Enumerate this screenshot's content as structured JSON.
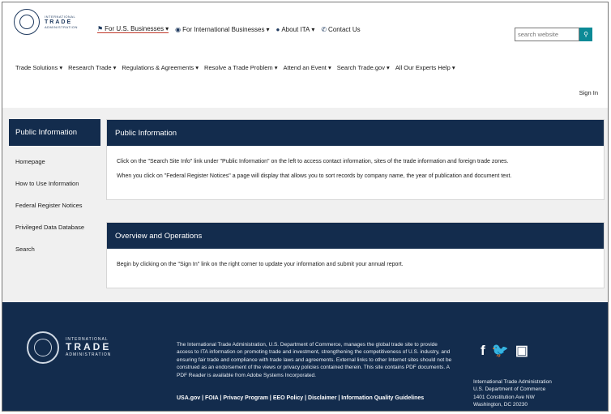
{
  "header": {
    "logo_small_top": "INTERNATIONAL",
    "logo_big": "TRADE",
    "logo_small_bottom": "ADMINISTRATION",
    "topnav": [
      {
        "label": "For U.S. Businesses",
        "icon": "flag-icon",
        "active": true
      },
      {
        "label": "For International Businesses",
        "icon": "globe-icon",
        "active": false
      },
      {
        "label": "About ITA",
        "icon": "info-icon",
        "active": false
      },
      {
        "label": "Contact Us",
        "icon": "phone-icon",
        "active": false
      }
    ],
    "search_placeholder": "search website",
    "search_icon": "search-icon",
    "mainnav": [
      "Trade Solutions",
      "Research Trade",
      "Regulations & Agreements",
      "Resolve a Trade Problem",
      "Attend an Event",
      "Search Trade.gov",
      "All Our Experts Help"
    ],
    "sign_in": "Sign In"
  },
  "sidebar": {
    "title": "Public Information",
    "items": [
      "Homepage",
      "How to Use Information",
      "Federal Register Notices",
      "Privileged Data Database",
      "Search"
    ]
  },
  "panels": [
    {
      "title": "Public Information",
      "paragraphs": [
        "Click on the \"Search Site Info\" link under \"Public Information\" on the left to access contact information, sites of the trade information and foreign trade zones.",
        "When you click on \"Federal Register Notices\" a page will display that allows you to sort records by company name, the year of publication and document text."
      ]
    },
    {
      "title": "Overview and Operations",
      "paragraphs": [
        "Begin by clicking on the \"Sign In\" link on the right corner to update your information and submit your annual report."
      ]
    }
  ],
  "footer": {
    "logo_small_top": "INTERNATIONAL",
    "logo_big": "TRADE",
    "logo_small_bottom": "ADMINISTRATION",
    "text": "The International Trade Administration, U.S. Department of Commerce, manages the global trade site to provide access to ITA information on promoting trade and investment, strengthening the competitiveness of U.S. industry, and ensuring fair trade and compliance with trade laws and agreements. External links to other Internet sites should not be construed as an endorsement of the views or privacy policies contained therein. This site contains PDF documents. A PDF Reader is available from Adobe Systems Incorporated.",
    "links": "USA.gov | FOIA | Privacy Program | EEO Policy | Disclaimer | Information Quality Guidelines",
    "social": [
      "f",
      "🐦",
      "▣"
    ],
    "address": [
      "International Trade Administration",
      "U.S. Department of Commerce",
      "1401 Constitution Ave NW",
      "Washington, DC 20230"
    ]
  },
  "colors": {
    "navy": "#132c4d",
    "search_button": "#0c8a96",
    "active_underline": "#c0392b",
    "content_bg": "#f0f0f0"
  }
}
